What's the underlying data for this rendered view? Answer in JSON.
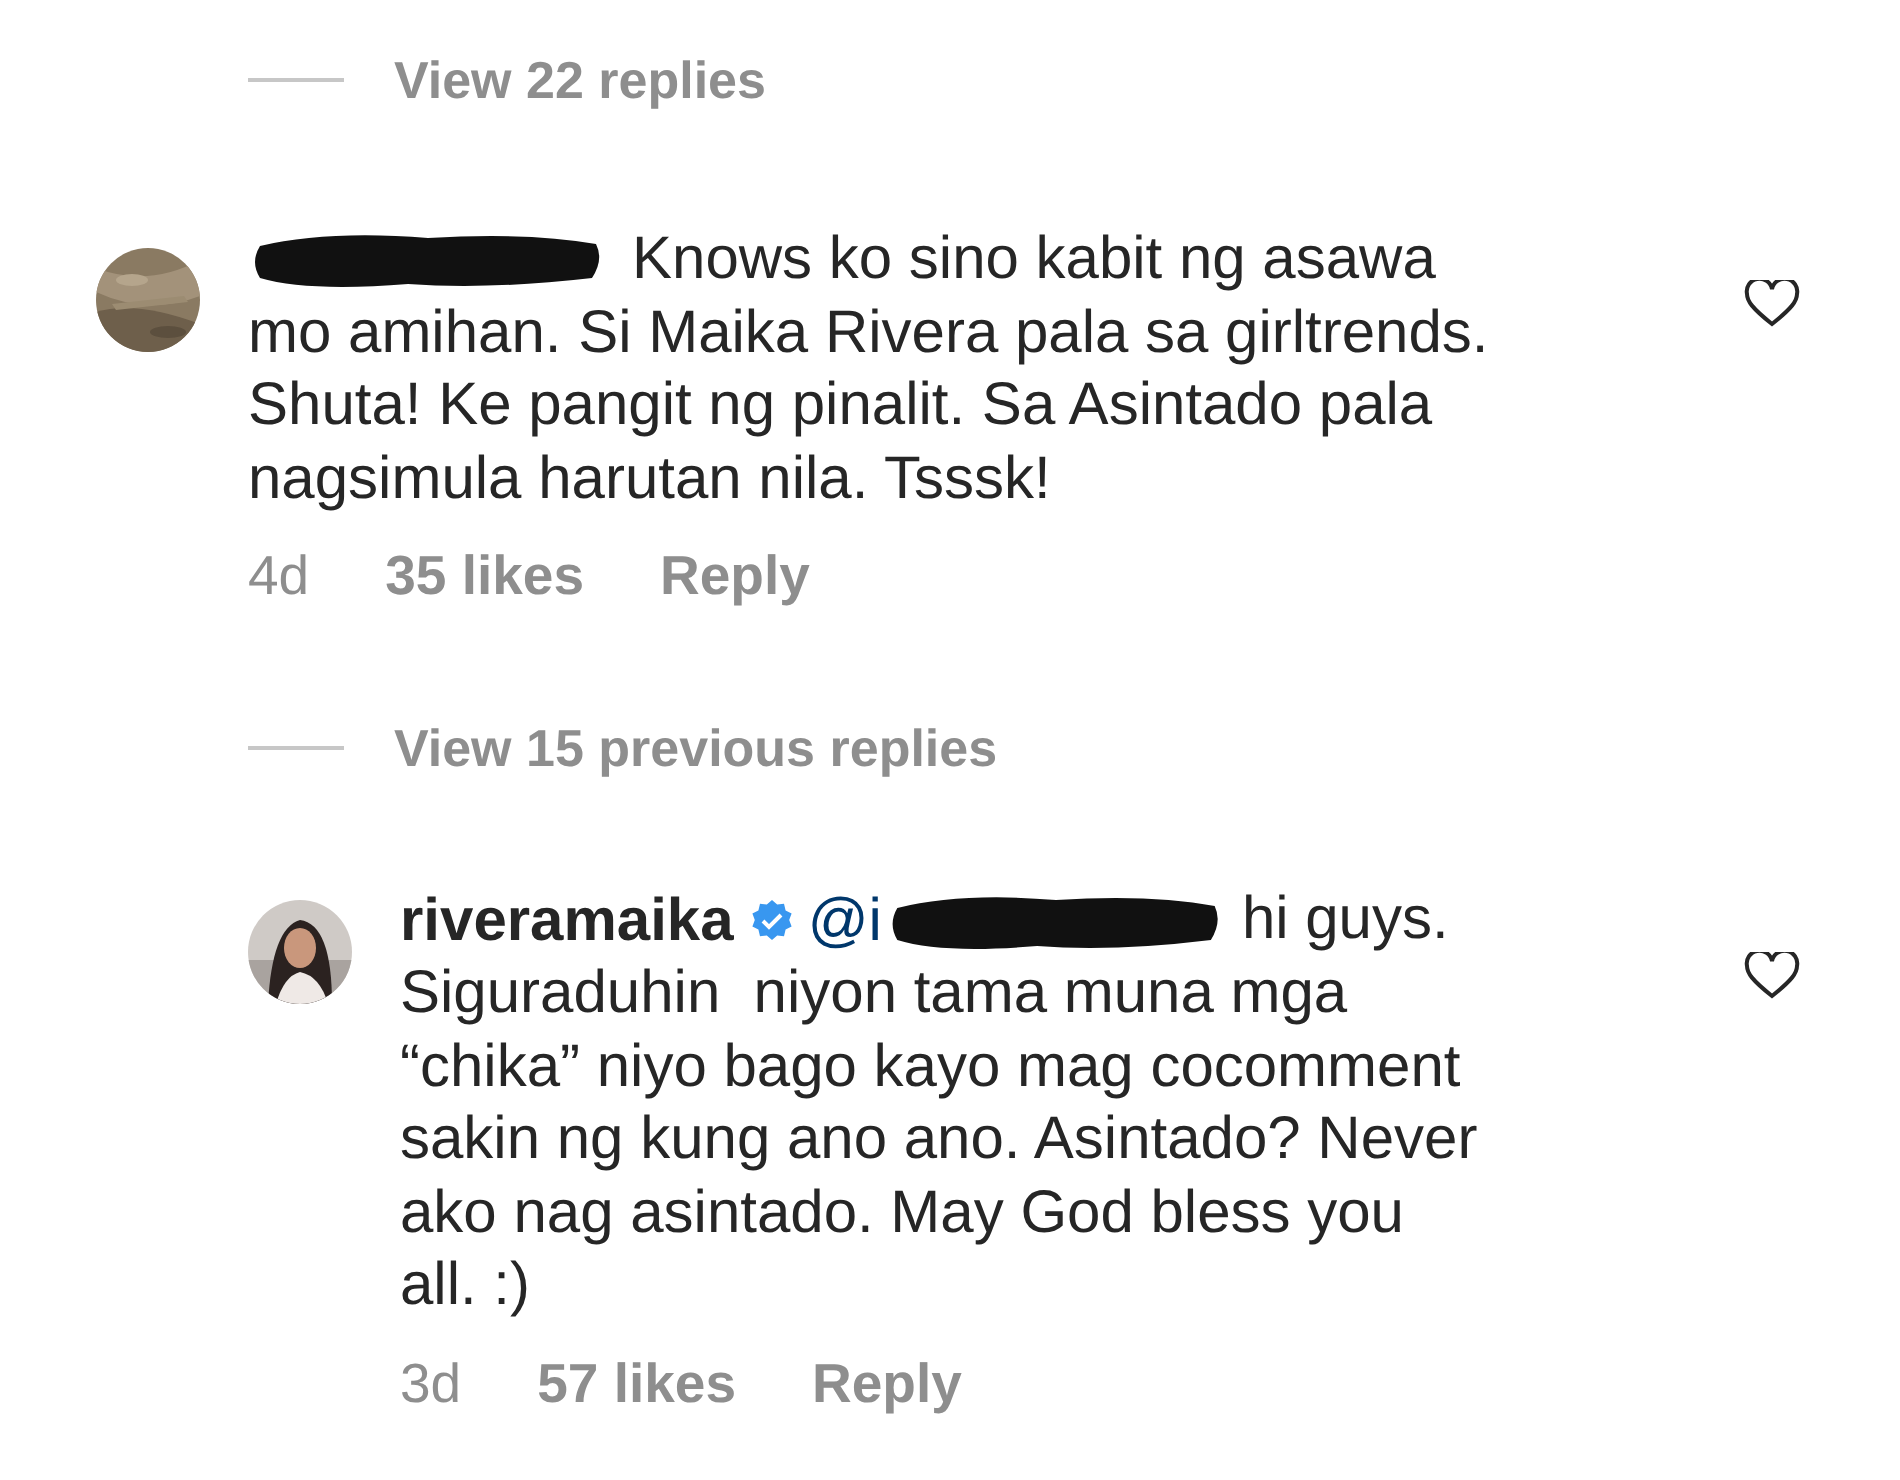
{
  "thread": [
    {
      "kind": "view_replies",
      "label": "View 22 replies"
    },
    {
      "kind": "comment",
      "username_hidden": true,
      "lines": [
        "Knows ko sino kabit ng asawa",
        "mo amihan. Si Maika Rivera pala sa girltrends.",
        "Shuta! Ke pangit ng pinalit. Sa Asintado pala",
        "nagsimula harutan nila. Tsssk!"
      ],
      "liked": false,
      "time": "4d",
      "likes": "35 likes",
      "reply": "Reply"
    },
    {
      "kind": "view_replies",
      "label": "View 15 previous replies"
    },
    {
      "kind": "comment",
      "username": "riveramaika",
      "verified": true,
      "mention": "@i",
      "mention_hidden": true,
      "lines": [
        "hi guys.",
        "Siguraduhin  niyon tama muna mga",
        "“chika” niyo bago kayo mag cocomment",
        "sakin ng kung ano ano. Asintado? Never",
        "ako nag asintado. May God bless you",
        "all. :)"
      ],
      "liked": false,
      "time": "3d",
      "likes": "57 likes",
      "reply": "Reply"
    }
  ]
}
